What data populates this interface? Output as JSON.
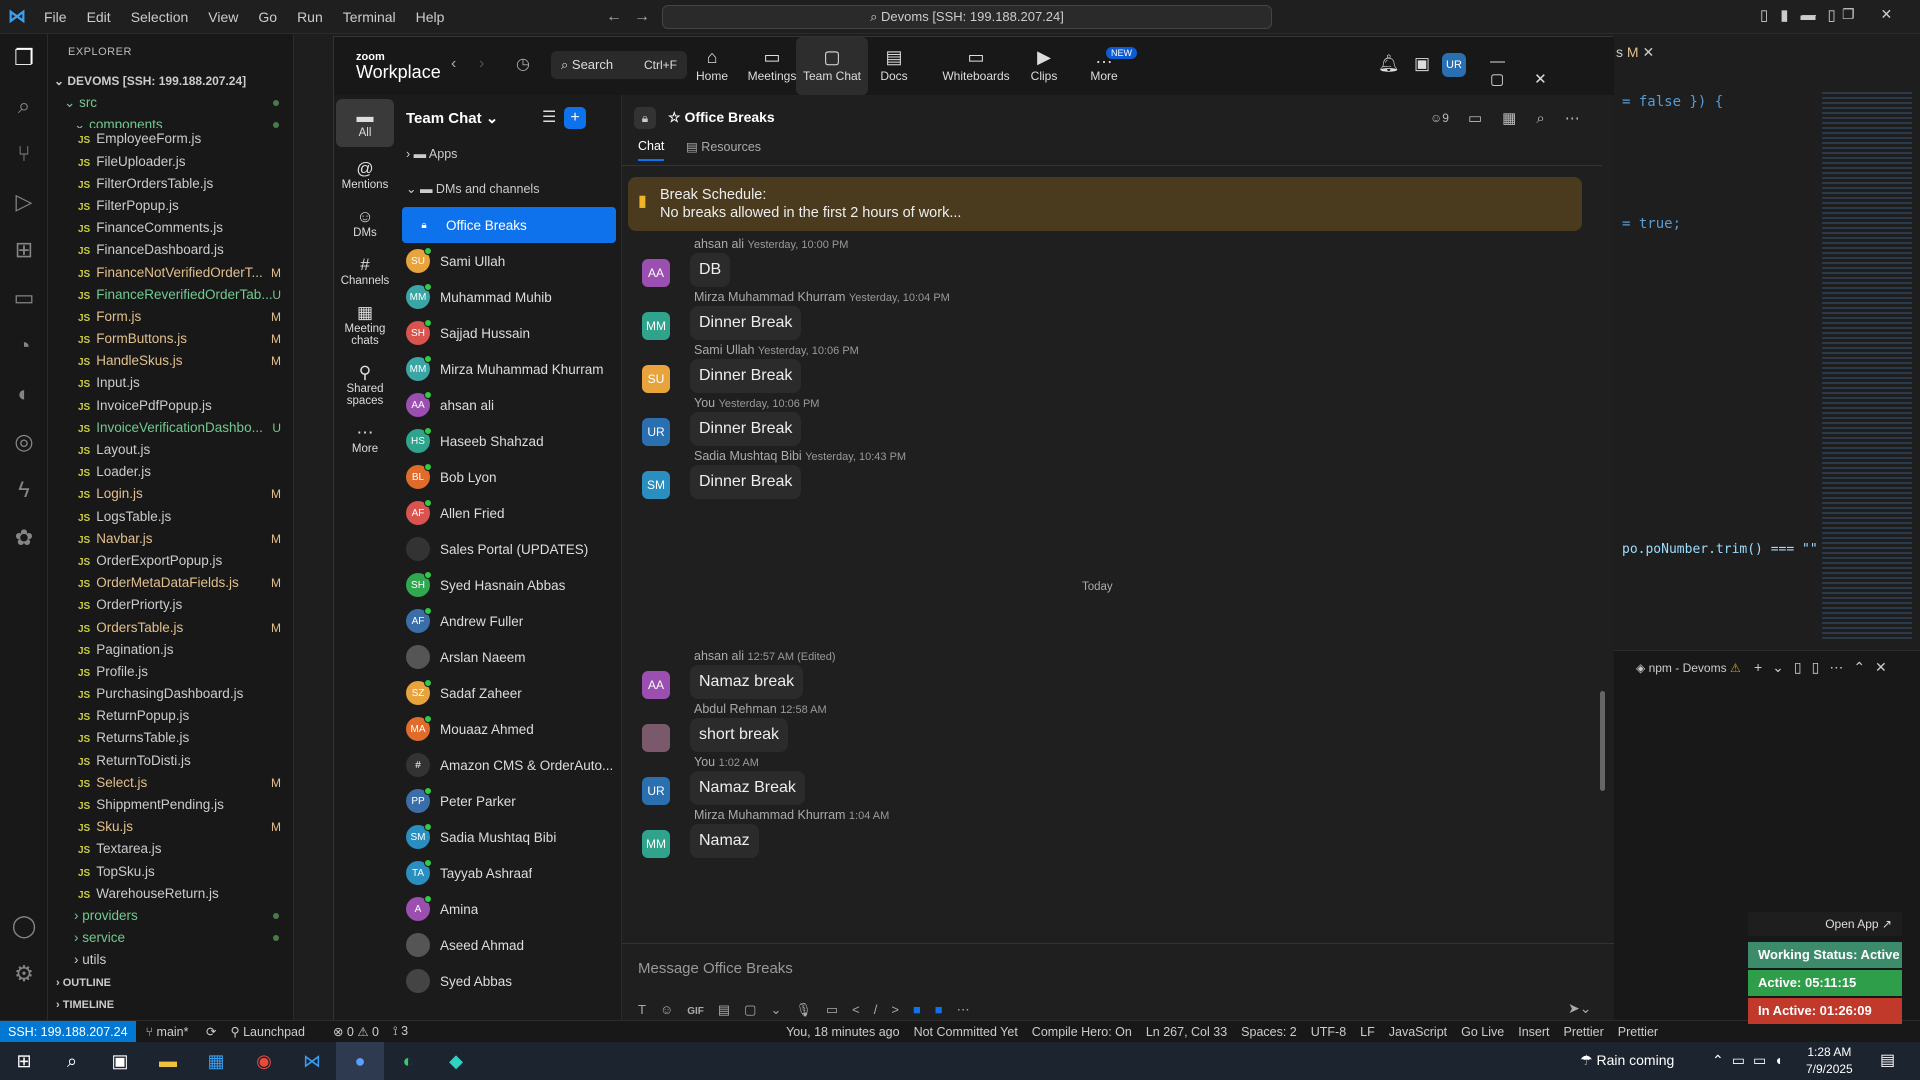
{
  "vscode": {
    "menu": [
      "File",
      "Edit",
      "Selection",
      "View",
      "Go",
      "Run",
      "Terminal",
      "Help"
    ],
    "command_center": "Devoms [SSH: 199.188.207.24]",
    "code_right": [
      "= false }) {",
      "= true;",
      "po.poNumber.trim() === \"\""
    ],
    "panel_label": "npm - Devoms",
    "tab_badge": "M"
  },
  "explorer": {
    "title": "EXPLORER",
    "root": "DEVOMS [SSH: 199.188.207.24]",
    "src": "src",
    "components": "components",
    "files": [
      {
        "n": "EmployeeForm.js",
        "b": "",
        "c": "#ccc"
      },
      {
        "n": "FileUploader.js",
        "b": "",
        "c": "#ccc"
      },
      {
        "n": "FilterOrdersTable.js",
        "b": "",
        "c": "#ccc"
      },
      {
        "n": "FilterPopup.js",
        "b": "",
        "c": "#ccc"
      },
      {
        "n": "FinanceComments.js",
        "b": "",
        "c": "#ccc"
      },
      {
        "n": "FinanceDashboard.js",
        "b": "",
        "c": "#ccc"
      },
      {
        "n": "FinanceNotVerifiedOrderT...",
        "b": "M",
        "c": "#e2c08d"
      },
      {
        "n": "FinanceReverifiedOrderTab...",
        "b": "U",
        "c": "#73c991"
      },
      {
        "n": "Form.js",
        "b": "M",
        "c": "#e2c08d"
      },
      {
        "n": "FormButtons.js",
        "b": "M",
        "c": "#e2c08d"
      },
      {
        "n": "HandleSkus.js",
        "b": "M",
        "c": "#e2c08d"
      },
      {
        "n": "Input.js",
        "b": "",
        "c": "#ccc"
      },
      {
        "n": "InvoicePdfPopup.js",
        "b": "",
        "c": "#ccc"
      },
      {
        "n": "InvoiceVerificationDashbo...",
        "b": "U",
        "c": "#73c991"
      },
      {
        "n": "Layout.js",
        "b": "",
        "c": "#ccc"
      },
      {
        "n": "Loader.js",
        "b": "",
        "c": "#ccc"
      },
      {
        "n": "Login.js",
        "b": "M",
        "c": "#e2c08d"
      },
      {
        "n": "LogsTable.js",
        "b": "",
        "c": "#ccc"
      },
      {
        "n": "Navbar.js",
        "b": "M",
        "c": "#e2c08d"
      },
      {
        "n": "OrderExportPopup.js",
        "b": "",
        "c": "#ccc"
      },
      {
        "n": "OrderMetaDataFields.js",
        "b": "M",
        "c": "#e2c08d"
      },
      {
        "n": "OrderPriorty.js",
        "b": "",
        "c": "#ccc"
      },
      {
        "n": "OrdersTable.js",
        "b": "M",
        "c": "#e2c08d"
      },
      {
        "n": "Pagination.js",
        "b": "",
        "c": "#ccc"
      },
      {
        "n": "Profile.js",
        "b": "",
        "c": "#ccc"
      },
      {
        "n": "PurchasingDashboard.js",
        "b": "",
        "c": "#ccc"
      },
      {
        "n": "ReturnPopup.js",
        "b": "",
        "c": "#ccc"
      },
      {
        "n": "ReturnsTable.js",
        "b": "",
        "c": "#ccc"
      },
      {
        "n": "ReturnToDisti.js",
        "b": "",
        "c": "#ccc"
      },
      {
        "n": "Select.js",
        "b": "M",
        "c": "#e2c08d"
      },
      {
        "n": "ShippmentPending.js",
        "b": "",
        "c": "#ccc"
      },
      {
        "n": "Sku.js",
        "b": "M",
        "c": "#e2c08d"
      },
      {
        "n": "Textarea.js",
        "b": "",
        "c": "#ccc"
      },
      {
        "n": "TopSku.js",
        "b": "",
        "c": "#ccc"
      },
      {
        "n": "WarehouseReturn.js",
        "b": "",
        "c": "#ccc"
      }
    ],
    "folders": [
      "providers",
      "service",
      "utils"
    ],
    "outline": "OUTLINE",
    "timeline": "TIMELINE"
  },
  "status": {
    "ssh": "SSH: 199.188.207.24",
    "branch": "main*",
    "launchpad": "Launchpad",
    "problems": "⊗ 0 ⚠ 0",
    "ports": "3",
    "blame": "You, 18 minutes ago",
    "commit": "Not Committed Yet",
    "hero": "Compile Hero: On",
    "pos": "Ln 267, Col 33",
    "spaces": "Spaces: 2",
    "enc": "UTF-8",
    "eol": "LF",
    "lang": "JavaScript",
    "golive": "Go Live",
    "insert": "Insert",
    "prettier": "Prettier",
    "prettier2": "Prettier"
  },
  "taskbar": {
    "weather": "Rain coming",
    "time": "1:28 AM",
    "date": "7/9/2025"
  },
  "zoom": {
    "logo_top": "zoom",
    "logo_bottom": "Workplace",
    "search": "Search",
    "search_shortcut": "Ctrl+F",
    "nav": [
      {
        "label": "Home",
        "icon": "⌂"
      },
      {
        "label": "Meetings",
        "icon": "▭"
      },
      {
        "label": "Team Chat",
        "icon": "▢"
      },
      {
        "label": "Docs",
        "icon": "▤"
      },
      {
        "label": "Whiteboards",
        "icon": "▭"
      },
      {
        "label": "Clips",
        "icon": "▶"
      },
      {
        "label": "More",
        "icon": "…"
      }
    ],
    "new_badge": "NEW",
    "user_initials": "UR",
    "left_tabs": [
      {
        "label": "All",
        "icon": "▬"
      },
      {
        "label": "Mentions",
        "icon": "@"
      },
      {
        "label": "DMs",
        "icon": "☺"
      },
      {
        "label": "Channels",
        "icon": "#"
      },
      {
        "label": "Meeting chats",
        "icon": "▦"
      },
      {
        "label": "Shared spaces",
        "icon": "⚲"
      },
      {
        "label": "More",
        "icon": "⋯"
      }
    ],
    "list_title": "Team Chat",
    "apps": "Apps",
    "dms_channels": "DMs and channels",
    "contacts": [
      {
        "name": "Office Breaks",
        "ini": "",
        "color": "#0e72ed",
        "active": true
      },
      {
        "name": "Sami Ullah",
        "ini": "SU",
        "color": "#e8a33c"
      },
      {
        "name": "Muhammad Muhib",
        "ini": "MM",
        "color": "#3aa5a5"
      },
      {
        "name": "Sajjad Hussain",
        "ini": "SH",
        "color": "#d9534f"
      },
      {
        "name": "Mirza Muhammad Khurram",
        "ini": "MM",
        "color": "#3aa5a5"
      },
      {
        "name": "ahsan ali",
        "ini": "AA",
        "color": "#9b4fb0"
      },
      {
        "name": "Haseeb Shahzad",
        "ini": "HS",
        "color": "#2fa38c"
      },
      {
        "name": "Bob Lyon",
        "ini": "BL",
        "color": "#e06c2c"
      },
      {
        "name": "Allen Fried",
        "ini": "AF",
        "color": "#d9534f"
      },
      {
        "name": "Sales Portal (UPDATES)",
        "ini": "",
        "color": "#333"
      },
      {
        "name": "Syed Hasnain Abbas",
        "ini": "SH",
        "color": "#2fa84f"
      },
      {
        "name": "Andrew Fuller",
        "ini": "AF",
        "color": "#3b6ea8"
      },
      {
        "name": "Arslan Naeem",
        "ini": "",
        "color": "#555"
      },
      {
        "name": "Sadaf Zaheer",
        "ini": "SZ",
        "color": "#e8a33c"
      },
      {
        "name": "Mouaaz Ahmed",
        "ini": "MA",
        "color": "#e06c2c"
      },
      {
        "name": "Amazon CMS & OrderAuto...",
        "ini": "#",
        "color": "#333"
      },
      {
        "name": "Peter Parker",
        "ini": "PP",
        "color": "#3b6ea8"
      },
      {
        "name": "Sadia Mushtaq Bibi",
        "ini": "SM",
        "color": "#2a8fc0"
      },
      {
        "name": "Tayyab Ashraaf",
        "ini": "TA",
        "color": "#2a8fc0"
      },
      {
        "name": "Amina",
        "ini": "A",
        "color": "#9b4fb0"
      },
      {
        "name": "Aseed Ahmad",
        "ini": "",
        "color": "#555"
      },
      {
        "name": "Syed Abbas",
        "ini": "",
        "color": "#444"
      }
    ],
    "channel_title": "Office Breaks",
    "members": "9",
    "tab_chat": "Chat",
    "tab_resources": "Resources",
    "pinned_title": "Break Schedule:",
    "pinned_body": "No breaks allowed in the first 2 hours of work...",
    "today": "Today",
    "messages": [
      {
        "author": "ahsan ali",
        "time": "Yesterday, 10:00 PM",
        "text": "DB",
        "ini": "AA",
        "color": "#9b4fb0"
      },
      {
        "author": "Mirza Muhammad Khurram",
        "time": "Yesterday, 10:04 PM",
        "text": "Dinner Break",
        "ini": "MM",
        "color": "#2fa38c"
      },
      {
        "author": "Sami Ullah",
        "time": "Yesterday, 10:06 PM",
        "text": "Dinner Break",
        "ini": "SU",
        "color": "#e8a33c"
      },
      {
        "author": "You",
        "time": "Yesterday, 10:06 PM",
        "text": "Dinner Break",
        "ini": "UR",
        "color": "#2a6fb0"
      },
      {
        "author": "Sadia Mushtaq Bibi",
        "time": "Yesterday, 10:43 PM",
        "text": "Dinner Break",
        "ini": "SM",
        "color": "#2a8fc0"
      },
      {
        "author": "ahsan ali",
        "time": "12:57 AM (Edited)",
        "text": "Namaz break",
        "ini": "AA",
        "color": "#9b4fb0"
      },
      {
        "author": "Abdul Rehman",
        "time": "12:58 AM",
        "text": "short break",
        "ini": "",
        "color": "#7a5a6a"
      },
      {
        "author": "You",
        "time": "1:02 AM",
        "text": "Namaz Break",
        "ini": "UR",
        "color": "#2a6fb0"
      },
      {
        "author": "Mirza Muhammad Khurram",
        "time": "1:04 AM",
        "text": "Namaz",
        "ini": "MM",
        "color": "#2fa38c"
      }
    ],
    "compose_placeholder": "Message Office Breaks",
    "gif": "GIF"
  },
  "widget": {
    "open_app": "Open App ↗",
    "working": "Working Status: Active",
    "active": "Active: 05:11:15",
    "inactive": "In Active: 01:26:09"
  }
}
